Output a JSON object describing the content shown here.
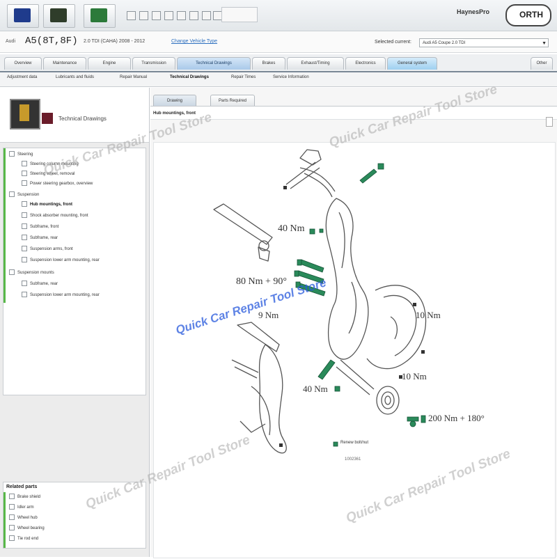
{
  "header": {
    "brand_top": "HaynesPro",
    "brand_main": "ORTH"
  },
  "vehicle": {
    "prefix": "Audi",
    "model": "A5(8T,8F)",
    "sub": "2.0 TDI (CAHA) 2008 - 2012",
    "link": "Change Vehicle Type",
    "select_label": "Selected current:",
    "select_value": "Audi A5 Coupe 2.0 TDI"
  },
  "tabs": [
    "Overview",
    "Maintenance",
    "Engine",
    "Transmission",
    "Technical Drawings",
    "Brakes",
    "Exhaust/Timing",
    "Electronics",
    "General system",
    "Other"
  ],
  "subtabs": [
    "Adjustment data",
    "Lubricants and fluids",
    "Repair Manual",
    "Technical Drawings",
    "Repair Times",
    "Service Information"
  ],
  "left": {
    "panel_title": "Technical Drawings",
    "tree": [
      {
        "label": "Steering",
        "level": 0,
        "bold": false
      },
      {
        "label": "Steering column mounting",
        "level": 1,
        "bold": false
      },
      {
        "label": "Steering wheel, removal",
        "level": 1,
        "bold": false
      },
      {
        "label": "Power steering gearbox, overview",
        "level": 1,
        "bold": false
      },
      {
        "label": "Suspension",
        "level": 0,
        "bold": false
      },
      {
        "label": "Hub mountings, front",
        "level": 1,
        "bold": true
      },
      {
        "label": "Shock absorber mounting, front",
        "level": 1,
        "bold": false
      },
      {
        "label": "Subframe, front",
        "level": 1,
        "bold": false
      },
      {
        "label": "Subframe, rear",
        "level": 1,
        "bold": false
      },
      {
        "label": "Suspension arms, front",
        "level": 1,
        "bold": false
      },
      {
        "label": "Suspension lower arm mounting, rear",
        "level": 1,
        "bold": false
      },
      {
        "label": "Suspension mounts",
        "level": 0,
        "bold": false
      },
      {
        "label": "Subframe, rear",
        "level": 1,
        "bold": false
      },
      {
        "label": "Suspension lower arm mounting, rear",
        "level": 1,
        "bold": false
      }
    ],
    "related_title": "Related parts",
    "related": [
      "Brake shield",
      "Idler arm",
      "Wheel hub",
      "Wheel bearing",
      "Tie rod end"
    ]
  },
  "content": {
    "tabs": [
      "Drawing",
      "Parts Required"
    ],
    "drawing_title": "Hub mountings, front",
    "torques": [
      "40 Nm",
      "80 Nm + 90°",
      "9 Nm",
      "10 Nm",
      "10 Nm",
      "40 Nm",
      "200 Nm + 180°"
    ],
    "legend": "Renew bolt/nut",
    "drawing_code": "1002361"
  },
  "watermark": "Quick Car Repair Tool Store"
}
